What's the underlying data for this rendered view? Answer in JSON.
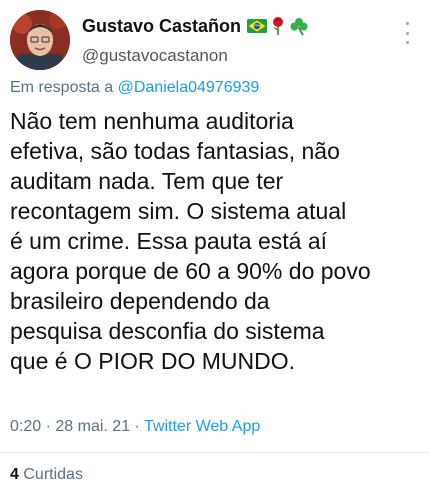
{
  "author": {
    "display_name": "Gustavo Castañon",
    "handle": "@gustavocastanon",
    "badges": [
      "brazil-flag-icon",
      "rose-icon",
      "shamrock-icon"
    ]
  },
  "reply": {
    "prefix": "Em resposta a",
    "mention": "@Daniela04976939"
  },
  "tweet": {
    "text": "Não tem nenhuma auditoria\nefetiva, são todas fantasias, não\nauditam nada. Tem que ter\nrecontagem sim. O sistema atual\né um crime. Essa pauta está aí\nagora porque de 60 a 90% do povo\nbrasileiro dependendo da\npesquisa desconfia do sistema\nque é O PIOR DO MUNDO.",
    "time": "0:20",
    "date": "28 mai. 21",
    "source": "Twitter Web App"
  },
  "stats": {
    "likes_count": "4",
    "likes_label": "Curtidas"
  },
  "colors": {
    "link": "#1d9bf0",
    "secondary_text": "#5b7083"
  }
}
